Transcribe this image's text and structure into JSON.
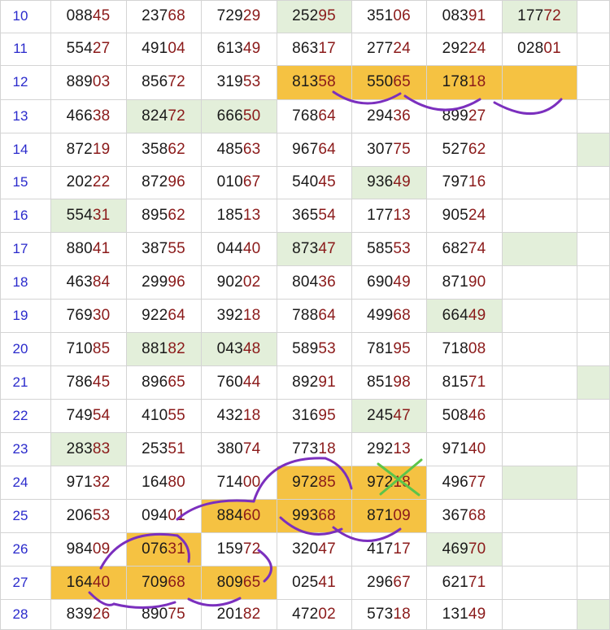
{
  "colors": {
    "green_fill": "#e3efda",
    "gold_fill": "#f5c242",
    "grid_line": "#d4d4d4",
    "row_number": "#2a2acc",
    "digits_head": "#1a1a1a",
    "digits_tail": "#8b1a1a",
    "stroke_purple": "#7b2fbe",
    "cross_green": "#5cc44a"
  },
  "rows": [
    {
      "num": "10",
      "cells": [
        {
          "v": "08845"
        },
        {
          "v": "23768"
        },
        {
          "v": "72929"
        },
        {
          "v": "25295",
          "f": "g"
        },
        {
          "v": "35106"
        },
        {
          "v": "08391"
        },
        {
          "v": "17772",
          "f": "g"
        },
        {
          "v": ""
        }
      ]
    },
    {
      "num": "11",
      "cells": [
        {
          "v": "55427"
        },
        {
          "v": "49104"
        },
        {
          "v": "61349"
        },
        {
          "v": "86317"
        },
        {
          "v": "27724"
        },
        {
          "v": "29224"
        },
        {
          "v": "02801"
        },
        {
          "v": ""
        }
      ]
    },
    {
      "num": "12",
      "cells": [
        {
          "v": "88903"
        },
        {
          "v": "85672"
        },
        {
          "v": "31953"
        },
        {
          "v": "81358",
          "f": "y"
        },
        {
          "v": "55065",
          "f": "y"
        },
        {
          "v": "17818",
          "f": "y"
        },
        {
          "v": "",
          "f": "y"
        },
        {
          "v": ""
        }
      ]
    },
    {
      "num": "13",
      "cells": [
        {
          "v": "46638"
        },
        {
          "v": "82472",
          "f": "g"
        },
        {
          "v": "66650",
          "f": "g"
        },
        {
          "v": "76864"
        },
        {
          "v": "29436"
        },
        {
          "v": "89927"
        },
        {
          "v": ""
        },
        {
          "v": ""
        }
      ]
    },
    {
      "num": "14",
      "cells": [
        {
          "v": "87219"
        },
        {
          "v": "35862"
        },
        {
          "v": "48563"
        },
        {
          "v": "96764"
        },
        {
          "v": "30775"
        },
        {
          "v": "52762"
        },
        {
          "v": ""
        },
        {
          "v": "",
          "f": "g"
        }
      ]
    },
    {
      "num": "15",
      "cells": [
        {
          "v": "20222"
        },
        {
          "v": "87296"
        },
        {
          "v": "01067"
        },
        {
          "v": "54045"
        },
        {
          "v": "93649",
          "f": "g"
        },
        {
          "v": "79716"
        },
        {
          "v": ""
        },
        {
          "v": ""
        }
      ]
    },
    {
      "num": "16",
      "cells": [
        {
          "v": "55431",
          "f": "g"
        },
        {
          "v": "89562"
        },
        {
          "v": "18513"
        },
        {
          "v": "36554"
        },
        {
          "v": "17713"
        },
        {
          "v": "90524"
        },
        {
          "v": ""
        },
        {
          "v": ""
        }
      ]
    },
    {
      "num": "17",
      "cells": [
        {
          "v": "88041"
        },
        {
          "v": "38755"
        },
        {
          "v": "04440"
        },
        {
          "v": "87347",
          "f": "g"
        },
        {
          "v": "58553"
        },
        {
          "v": "68274"
        },
        {
          "v": "",
          "f": "g"
        },
        {
          "v": ""
        }
      ]
    },
    {
      "num": "18",
      "cells": [
        {
          "v": "46384"
        },
        {
          "v": "29996"
        },
        {
          "v": "90202"
        },
        {
          "v": "80436"
        },
        {
          "v": "69049"
        },
        {
          "v": "87190"
        },
        {
          "v": ""
        },
        {
          "v": ""
        }
      ]
    },
    {
      "num": "19",
      "cells": [
        {
          "v": "76930"
        },
        {
          "v": "92264"
        },
        {
          "v": "39218"
        },
        {
          "v": "78864"
        },
        {
          "v": "49968"
        },
        {
          "v": "66449",
          "f": "g"
        },
        {
          "v": ""
        },
        {
          "v": ""
        }
      ]
    },
    {
      "num": "20",
      "cells": [
        {
          "v": "71085"
        },
        {
          "v": "88182",
          "f": "g"
        },
        {
          "v": "04348",
          "f": "g"
        },
        {
          "v": "58953"
        },
        {
          "v": "78195"
        },
        {
          "v": "71808"
        },
        {
          "v": ""
        },
        {
          "v": ""
        }
      ]
    },
    {
      "num": "21",
      "cells": [
        {
          "v": "78645"
        },
        {
          "v": "89665"
        },
        {
          "v": "76044"
        },
        {
          "v": "89291"
        },
        {
          "v": "85198"
        },
        {
          "v": "81571"
        },
        {
          "v": ""
        },
        {
          "v": "",
          "f": "g"
        }
      ]
    },
    {
      "num": "22",
      "cells": [
        {
          "v": "74954"
        },
        {
          "v": "41055"
        },
        {
          "v": "43218"
        },
        {
          "v": "31695"
        },
        {
          "v": "24547",
          "f": "g"
        },
        {
          "v": "50846"
        },
        {
          "v": ""
        },
        {
          "v": ""
        }
      ]
    },
    {
      "num": "23",
      "cells": [
        {
          "v": "28383",
          "f": "g"
        },
        {
          "v": "25351"
        },
        {
          "v": "38074"
        },
        {
          "v": "77318"
        },
        {
          "v": "29213"
        },
        {
          "v": "97140"
        },
        {
          "v": ""
        },
        {
          "v": ""
        }
      ]
    },
    {
      "num": "24",
      "cells": [
        {
          "v": "97132"
        },
        {
          "v": "16480"
        },
        {
          "v": "71400"
        },
        {
          "v": "97285",
          "f": "y"
        },
        {
          "v": "97218",
          "f": "y"
        },
        {
          "v": "49677"
        },
        {
          "v": "",
          "f": "g"
        },
        {
          "v": ""
        }
      ]
    },
    {
      "num": "25",
      "cells": [
        {
          "v": "20653"
        },
        {
          "v": "09401"
        },
        {
          "v": "88460",
          "f": "y"
        },
        {
          "v": "99368",
          "f": "y"
        },
        {
          "v": "87109",
          "f": "y"
        },
        {
          "v": "36768"
        },
        {
          "v": ""
        },
        {
          "v": ""
        }
      ]
    },
    {
      "num": "26",
      "cells": [
        {
          "v": "98409"
        },
        {
          "v": "07631",
          "f": "y"
        },
        {
          "v": "15972"
        },
        {
          "v": "32047"
        },
        {
          "v": "41717"
        },
        {
          "v": "46970",
          "f": "g"
        },
        {
          "v": ""
        },
        {
          "v": ""
        }
      ]
    },
    {
      "num": "27",
      "cells": [
        {
          "v": "16440",
          "f": "y"
        },
        {
          "v": "70968",
          "f": "y"
        },
        {
          "v": "80965",
          "f": "y"
        },
        {
          "v": "02541"
        },
        {
          "v": "29667"
        },
        {
          "v": "62171"
        },
        {
          "v": ""
        },
        {
          "v": ""
        }
      ]
    },
    {
      "num": "28",
      "cells": [
        {
          "v": "83926"
        },
        {
          "v": "89075"
        },
        {
          "v": "20182"
        },
        {
          "v": "47202"
        },
        {
          "v": "57318"
        },
        {
          "v": "13149"
        },
        {
          "v": ""
        },
        {
          "v": "",
          "f": "g"
        }
      ]
    }
  ],
  "annotations": {
    "crossed_out_value": "97218"
  }
}
